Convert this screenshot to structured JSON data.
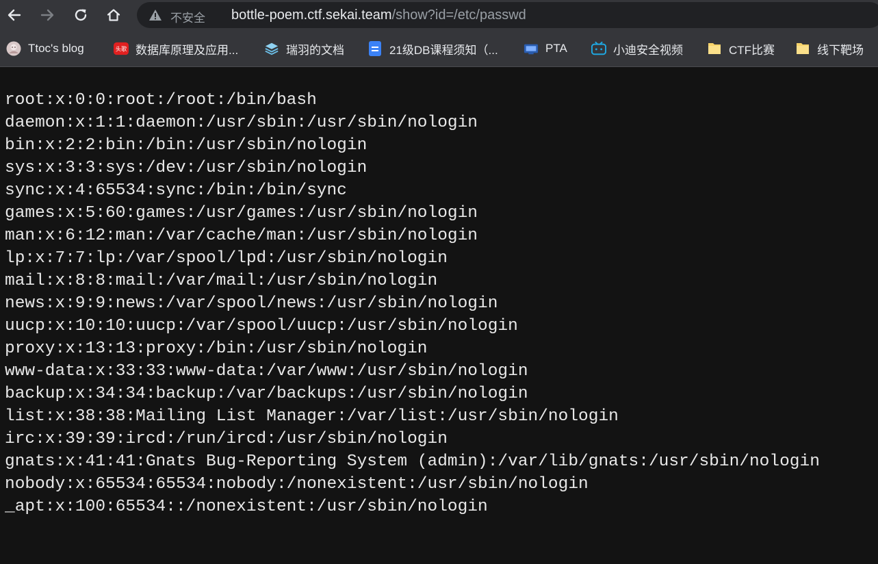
{
  "toolbar": {
    "security_label": "不安全",
    "url_host": "bottle-poem.ctf.sekai.team",
    "url_path": "/show?id=/etc/passwd"
  },
  "bookmarks": [
    {
      "label": "Ttoc's blog",
      "icon": "avatar-icon"
    },
    {
      "label": "数据库原理及应用...",
      "icon": "toutiao-icon",
      "icon_text": "头歌"
    },
    {
      "label": "瑞羽的文档",
      "icon": "layers-icon"
    },
    {
      "label": "21级DB课程须知（...",
      "icon": "doc-icon"
    },
    {
      "label": "PTA",
      "icon": "pta-icon"
    },
    {
      "label": "小迪安全视频",
      "icon": "bilibili-icon"
    },
    {
      "label": "CTF比赛",
      "icon": "folder-icon"
    },
    {
      "label": "线下靶场",
      "icon": "folder-icon"
    }
  ],
  "colors": {
    "toolbar_bg": "#35363a",
    "omnibox_bg": "#202124",
    "page_bg": "#131313",
    "text": "#e8e8e8"
  },
  "content": {
    "lines": [
      "root:x:0:0:root:/root:/bin/bash",
      "daemon:x:1:1:daemon:/usr/sbin:/usr/sbin/nologin",
      "bin:x:2:2:bin:/bin:/usr/sbin/nologin",
      "sys:x:3:3:sys:/dev:/usr/sbin/nologin",
      "sync:x:4:65534:sync:/bin:/bin/sync",
      "games:x:5:60:games:/usr/games:/usr/sbin/nologin",
      "man:x:6:12:man:/var/cache/man:/usr/sbin/nologin",
      "lp:x:7:7:lp:/var/spool/lpd:/usr/sbin/nologin",
      "mail:x:8:8:mail:/var/mail:/usr/sbin/nologin",
      "news:x:9:9:news:/var/spool/news:/usr/sbin/nologin",
      "uucp:x:10:10:uucp:/var/spool/uucp:/usr/sbin/nologin",
      "proxy:x:13:13:proxy:/bin:/usr/sbin/nologin",
      "www-data:x:33:33:www-data:/var/www:/usr/sbin/nologin",
      "backup:x:34:34:backup:/var/backups:/usr/sbin/nologin",
      "list:x:38:38:Mailing List Manager:/var/list:/usr/sbin/nologin",
      "irc:x:39:39:ircd:/run/ircd:/usr/sbin/nologin",
      "gnats:x:41:41:Gnats Bug-Reporting System (admin):/var/lib/gnats:/usr/sbin/nologin",
      "nobody:x:65534:65534:nobody:/nonexistent:/usr/sbin/nologin",
      "_apt:x:100:65534::/nonexistent:/usr/sbin/nologin"
    ]
  }
}
